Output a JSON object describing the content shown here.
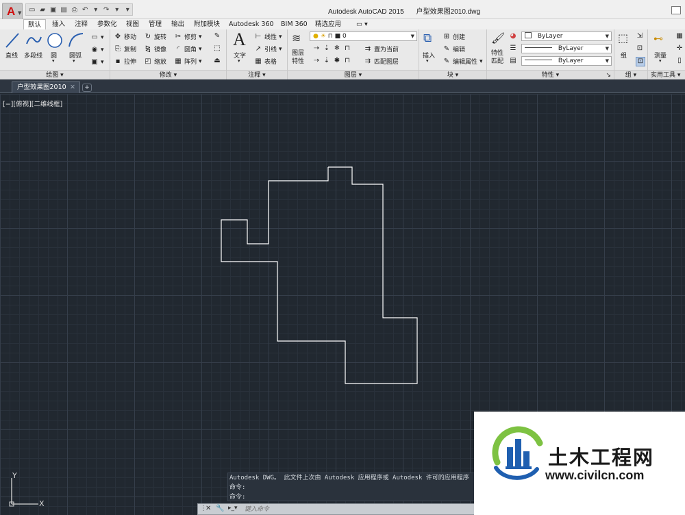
{
  "titlebar": {
    "app_title": "Autodesk AutoCAD 2015",
    "file_name": "户型效果图2010.dwg"
  },
  "tabs": [
    "默认",
    "插入",
    "注释",
    "参数化",
    "视图",
    "管理",
    "输出",
    "附加模块",
    "Autodesk 360",
    "BIM 360",
    "精选应用",
    "▭ ▾"
  ],
  "ribbon": {
    "draw": {
      "line": "直线",
      "polyline": "多段线",
      "circle": "圆",
      "arc": "圆弧",
      "footer": "绘图 ▾"
    },
    "modify": {
      "move": "移动",
      "rotate": "旋转",
      "trim": "修剪",
      "copy": "复制",
      "mirror": "镜像",
      "fillet": "圆角",
      "stretch": "拉伸",
      "scale": "缩放",
      "array": "阵列",
      "footer": "修改 ▾"
    },
    "annotation": {
      "text": "文字",
      "dimension": "线性",
      "leader": "引线",
      "table": "表格",
      "footer": "注释 ▾"
    },
    "layers": {
      "properties_line1": "图层",
      "properties_line2": "特性",
      "current_layer": "0",
      "set_current": "置为当前",
      "match_layer": "匹配图层",
      "footer": "图层 ▾"
    },
    "block": {
      "insert": "插入",
      "create": "创建",
      "edit": "编辑",
      "edit_attributes": "编辑属性",
      "footer": "块 ▾"
    },
    "properties": {
      "match_line1": "特性",
      "match_line2": "匹配",
      "color": "ByLayer",
      "linetype": "ByLayer",
      "lineweight": "ByLayer",
      "footer": "特性 ▾"
    },
    "group": {
      "group": "组",
      "footer": "组 ▾"
    },
    "utilities": {
      "measure": "测量",
      "footer": "实用工具 ▾"
    }
  },
  "document": {
    "tab_label": "户型效果图2010"
  },
  "viewport": {
    "label": "[−][俯视][二维线框]"
  },
  "ucs": {
    "x": "X",
    "y": "Y"
  },
  "command": {
    "history": [
      "Autodesk DWG。  此文件上次由 Autodesk 应用程序或 Autodesk 许可的应用程序",
      "命令:",
      "命令:"
    ],
    "placeholder": "键入命令"
  },
  "watermark": {
    "title": "土木工程网",
    "url": "www.civilcn.com"
  },
  "colors": {
    "canvas": "#212830",
    "ribbon": "#e9e9e9",
    "outline": "#ffffff",
    "watermark_blue": "#1f5fb0",
    "watermark_green": "#7dc242"
  }
}
